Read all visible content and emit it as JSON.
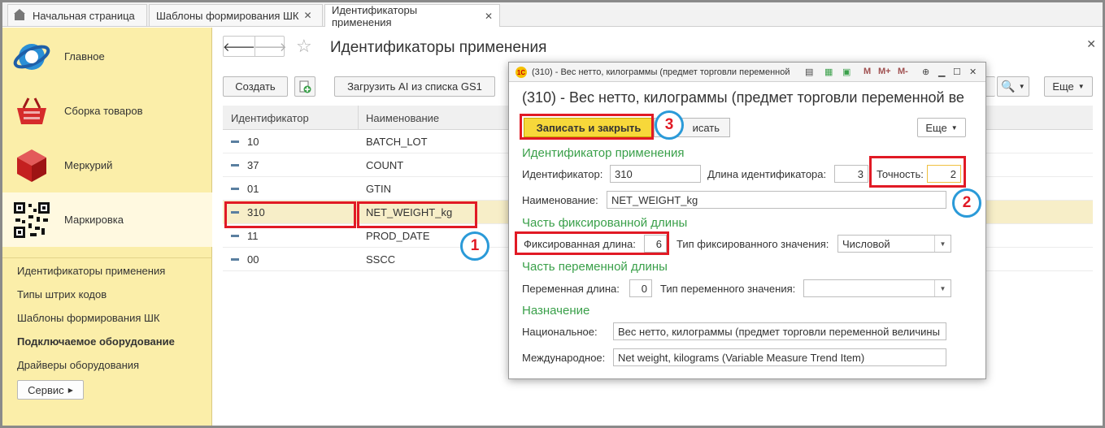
{
  "tabs": [
    {
      "label": "Начальная страница",
      "closable": false
    },
    {
      "label": "Шаблоны формирования ШК",
      "closable": true
    },
    {
      "label": "Идентификаторы применения",
      "closable": true,
      "active": true
    }
  ],
  "sidebar": {
    "sections": [
      {
        "label": "Главное",
        "icon": "globe-icon"
      },
      {
        "label": "Сборка товаров",
        "icon": "basket-icon"
      },
      {
        "label": "Меркурий",
        "icon": "cube-icon"
      },
      {
        "label": "Маркировка",
        "icon": "qr-code-icon",
        "active": true
      }
    ],
    "links": [
      {
        "label": "Идентификаторы применения",
        "bold": false
      },
      {
        "label": "Типы штрих кодов",
        "bold": false
      },
      {
        "label": "Шаблоны формирования ШК",
        "bold": false
      },
      {
        "label": "Подключаемое оборудование",
        "bold": true
      },
      {
        "label": "Драйверы оборудования",
        "bold": false
      }
    ],
    "service_button": "Сервис"
  },
  "main": {
    "title": "Идентификаторы применения",
    "toolbar": {
      "create": "Создать",
      "load": "Загрузить AI из списка GS1",
      "more": "Еще"
    },
    "table": {
      "columns": [
        "Идентификатор",
        "Наименование"
      ],
      "rows": [
        {
          "id": "10",
          "name": "BATCH_LOT"
        },
        {
          "id": "37",
          "name": "COUNT"
        },
        {
          "id": "01",
          "name": "GTIN"
        },
        {
          "id": "310",
          "name": "NET_WEIGHT_kg",
          "selected": true
        },
        {
          "id": "11",
          "name": "PROD_DATE"
        },
        {
          "id": "00",
          "name": "SSCC"
        }
      ]
    }
  },
  "dialog": {
    "window_title": "(310) - Вес нетто, килограммы (предмет торговли переменной",
    "window_icon_text": "1С",
    "toolbar_icons": {
      "m": "M",
      "m_plus": "M+",
      "m_minus": "M-"
    },
    "heading": "(310) - Вес нетто, килограммы (предмет торговли переменной ве",
    "save_close": "Записать и закрыть",
    "write": "исать",
    "more": "Еще",
    "group_identifier": "Идентификатор применения",
    "identifier_label": "Идентификатор:",
    "identifier_value": "310",
    "id_length_label": "Длина идентификатора:",
    "id_length_value": "3",
    "precision_label": "Точность:",
    "precision_value": "2",
    "name_label": "Наименование:",
    "name_value": "NET_WEIGHT_kg",
    "group_fixed": "Часть фиксированной длины",
    "fixed_length_label": "Фиксированная длина:",
    "fixed_length_value": "6",
    "fixed_type_label": "Тип фиксированного значения:",
    "fixed_type_value": "Числовой",
    "group_variable": "Часть переменной длины",
    "var_length_label": "Переменная длина:",
    "var_length_value": "0",
    "var_type_label": "Тип переменного значения:",
    "var_type_value": "",
    "group_purpose": "Назначение",
    "national_label": "Национальное:",
    "national_value": "Вес нетто, килограммы (предмет торговли переменной величины",
    "international_label": "Международное:",
    "international_value": "Net weight, kilograms (Variable Measure Trend Item)"
  },
  "annotations": [
    "1",
    "2",
    "3"
  ],
  "colors": {
    "accent_red": "#e11a25",
    "circle_blue": "#2a9ad8",
    "sidebar": "#fbeea9",
    "save_button": "#f7d83a",
    "group_heading": "#3aa04a"
  }
}
